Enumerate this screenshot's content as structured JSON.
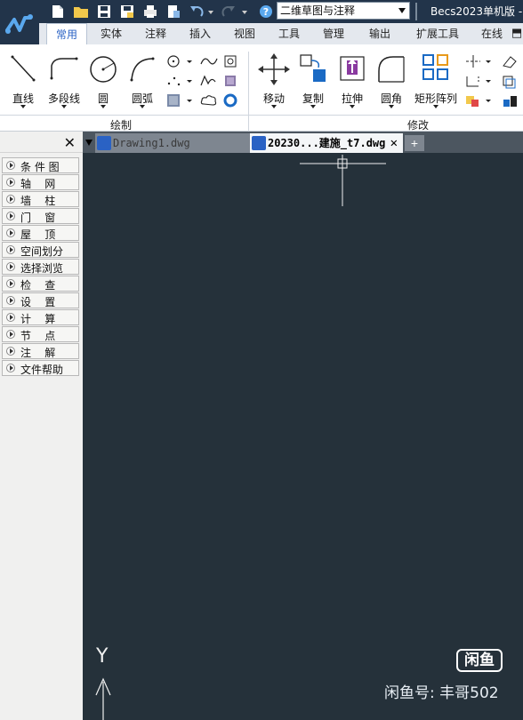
{
  "titlebar": {
    "app_title": "Becs2023单机版 -",
    "workspace": "二维草图与注释",
    "quick_access": [
      "new-icon",
      "open-icon",
      "save-icon",
      "save-as-icon",
      "print-icon",
      "publish-icon",
      "undo-icon",
      "redo-icon",
      "help-icon"
    ],
    "help_label": "?"
  },
  "tabs": [
    "常用",
    "实体",
    "注释",
    "插入",
    "视图",
    "工具",
    "管理",
    "输出",
    "扩展工具",
    "在线"
  ],
  "active_tab": "常用",
  "ribbon": {
    "draw_tools": [
      "直线",
      "多段线",
      "圆",
      "圆弧"
    ],
    "modify_tools": [
      "移动",
      "复制",
      "拉伸",
      "圆角",
      "矩形阵列"
    ],
    "groups": {
      "draw": "绘制",
      "modify": "修改"
    }
  },
  "left_panel": {
    "close_label": "✕",
    "items": [
      "条 件 图",
      "轴    网",
      "墙    柱",
      "门    窗",
      "屋    顶",
      "空间划分",
      "选择浏览",
      "检    查",
      "设    置",
      "计    算",
      "节    点",
      "注    解",
      "文件帮助"
    ]
  },
  "doc_tabs": {
    "tab1": "Drawing1.dwg",
    "tab2": "20230...建施_t7.dwg",
    "close": "✕",
    "new_tab": "+"
  },
  "canvas": {
    "ucs_y_label": "Y"
  },
  "watermark": {
    "badge": "闲鱼",
    "text": "闲鱼号: 丰哥502"
  },
  "colors": {
    "title_bg": "#22344a",
    "canvas_bg": "#25313a",
    "active_tab": "#2a62c4"
  }
}
